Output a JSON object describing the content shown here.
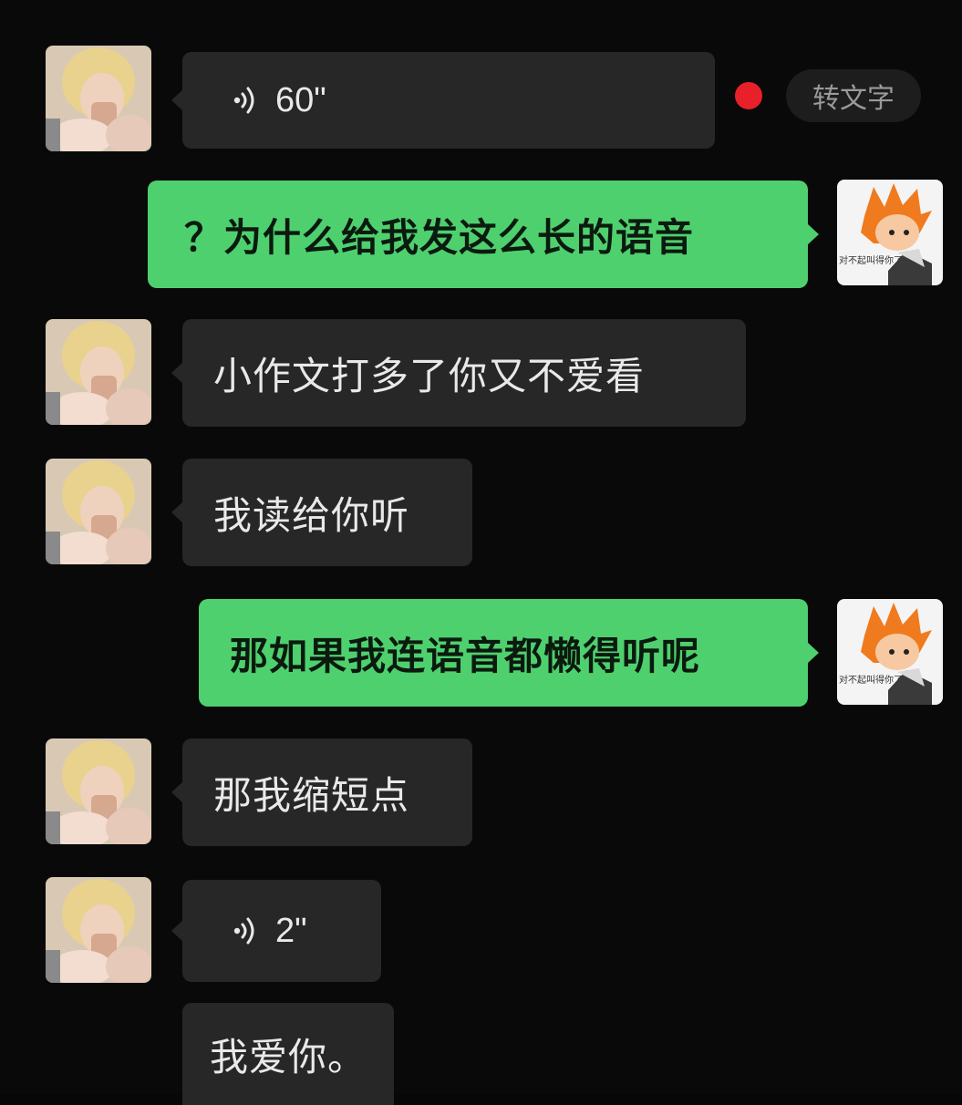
{
  "messages": {
    "m1": {
      "duration": "60\""
    },
    "m2": {
      "text": "？为什么给我发这么长的语音"
    },
    "m3": {
      "text": "小作文打多了你又不爱看"
    },
    "m4": {
      "text": "我读给你听"
    },
    "m5": {
      "text": "那如果我连语音都懒得听呢"
    },
    "m6": {
      "text": "那我缩短点"
    },
    "m7": {
      "duration": "2\""
    },
    "m8": {
      "text": "我爱你。"
    }
  },
  "convert_button": {
    "label": "转文字"
  },
  "my_avatar": {
    "caption": "对不起叫得你了"
  },
  "colors": {
    "background": "#090909",
    "incoming_bubble": "#272727",
    "outgoing_bubble": "#4fd06f",
    "unread_dot": "#e8202a"
  },
  "icons": {
    "voice": "voice-wave-icon",
    "unread": "unread-dot"
  }
}
